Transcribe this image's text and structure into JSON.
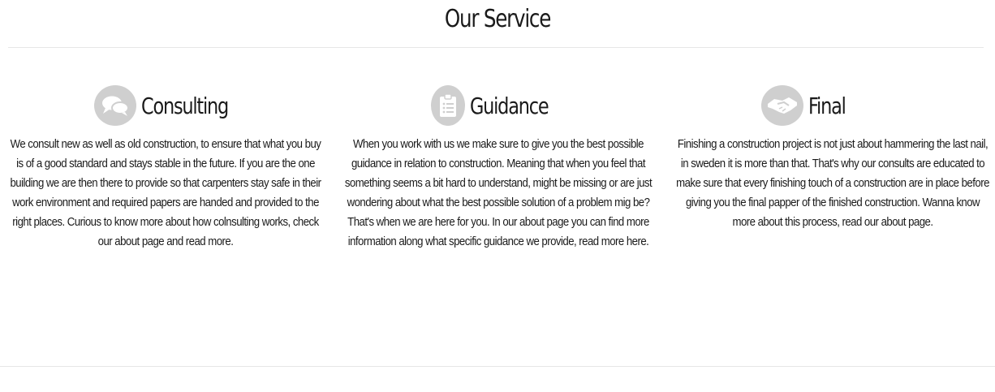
{
  "section": {
    "title": "Our Service"
  },
  "services": [
    {
      "icon": "chat-bubbles-icon",
      "title": "Consulting",
      "text": "We consult new as well as old construction, to ensure that what you buy is of a good standard and stays stable in the future. If you are the one building we are then there to provide so that carpenters stay safe in their work environment and required papers are handed and provided to the right places. Curious to know more about how colnsulting works, check our about page and read more."
    },
    {
      "icon": "clipboard-list-icon",
      "title": "Guidance",
      "text": "When you work with us we make sure to give you the best possible guidance in relation to construction. Meaning that when you feel that something seems a bit hard to understand, might be missing or are just wondering about what the best possible solution of a problem mig be? That's when we are here for you. In our about page you can find more information along what specific guidance we provide, read more here."
    },
    {
      "icon": "handshake-icon",
      "title": "Final",
      "text": "Finishing a construction project is not just about hammering the last nail, in sweden it is more than that. That's why our consults are educated to make sure that every finishing touch of a construction are in place before giving you the final papper of the finished construction. Wanna know more about this process, read our about page."
    }
  ],
  "colors": {
    "icon_bg": "#cfcfcf",
    "rule": "#e6e6e6",
    "text": "#1a1a1a"
  }
}
